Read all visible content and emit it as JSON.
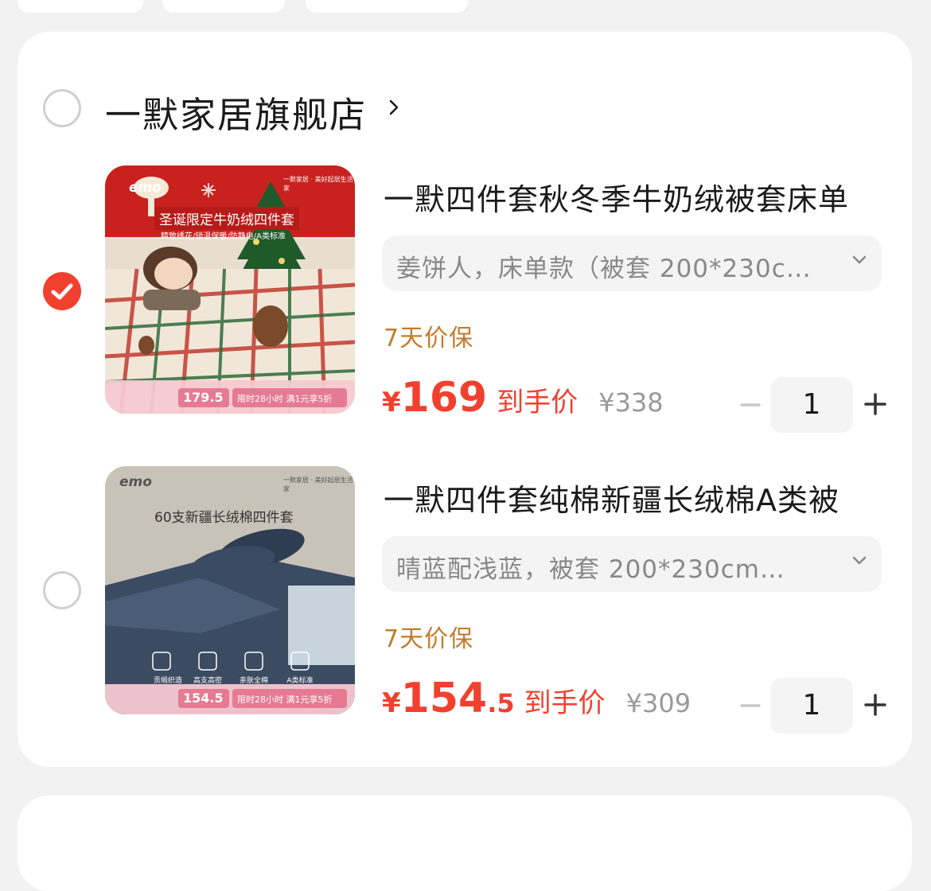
{
  "store": {
    "name": "一默家居旗舰店",
    "checked": false
  },
  "items": [
    {
      "checked": true,
      "title": "一默四件套秋冬季牛奶绒被套床单",
      "sku": "姜饼人，床单款（被套 200*230c…",
      "guarantee": "7天价保",
      "price_yen": "¥",
      "price_int": "169",
      "price_dec": "",
      "price_tag": "到手价",
      "original_price": "¥338",
      "quantity": "1",
      "thumb": {
        "brand": "emo",
        "headline": "圣诞限定牛奶绒四件套",
        "subline": "精致绣花/锁温保暖/防静电/A类标准",
        "store_tag": "一默家居 · 美好起居生活家",
        "promo_price": "179.5",
        "promo_text": "限时28小时 满1元享5折"
      }
    },
    {
      "checked": false,
      "title": "一默四件套纯棉新疆长绒棉A类被",
      "sku": "晴蓝配浅蓝，被套 200*230cm…",
      "guarantee": "7天价保",
      "price_yen": "¥",
      "price_int": "154",
      "price_dec": ".5",
      "price_tag": "到手价",
      "original_price": "¥309",
      "quantity": "1",
      "thumb": {
        "brand": "emo",
        "headline": "60支新疆长绒棉四件套",
        "store_tag": "一默家居 · 美好起居生活家",
        "features": [
          "贡缎织造",
          "高支高密",
          "亲肤全棉",
          "A类标准"
        ],
        "promo_price": "154.5",
        "promo_text": "限时28小时 满1元享5折"
      }
    }
  ],
  "colors": {
    "accent_red": "#f2402f",
    "guarantee_gold": "#c47a2a",
    "muted_text": "#999999"
  },
  "icons": {
    "store_chevron": "chevron-right-icon",
    "sku_chevron": "chevron-down-icon",
    "check": "check-icon",
    "minus": "minus-icon",
    "plus": "plus-icon"
  }
}
